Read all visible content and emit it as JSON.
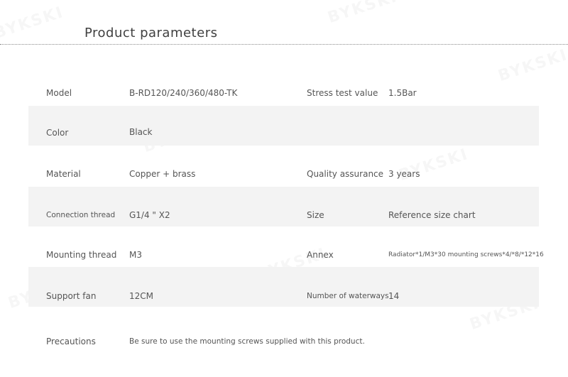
{
  "title": "Product parameters",
  "watermark_text": "BYKSKI",
  "rows": [
    {
      "label": "Model",
      "value": "B-RD120/240/360/480-TK",
      "label2": "Stress test value",
      "value2": "1.5Bar"
    },
    {
      "label": "Color",
      "value": "Black",
      "label2": "",
      "value2": ""
    },
    {
      "label": "Material",
      "value": "Copper + brass",
      "label2": "Quality assurance",
      "value2": "3 years"
    },
    {
      "label": "Connection thread",
      "value": "G1/4 \" X2",
      "label2": "Size",
      "value2": "Reference size chart"
    },
    {
      "label": "Mounting thread",
      "value": "M3",
      "label2": "Annex",
      "value2": "Radiator*1/M3*30 mounting screws*4/*8/*12*16"
    },
    {
      "label": "Support fan",
      "value": "12CM",
      "label2": "Number of waterways",
      "value2": "14"
    }
  ],
  "precautions": {
    "label": "Precautions",
    "value": "Be sure to use the mounting screws supplied with this product."
  }
}
